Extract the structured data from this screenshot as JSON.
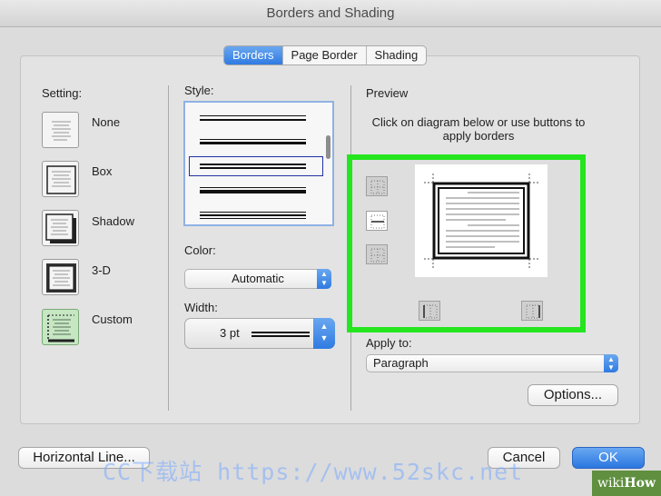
{
  "window": {
    "title": "Borders and Shading"
  },
  "tabs": [
    {
      "label": "Borders",
      "active": true
    },
    {
      "label": "Page Border",
      "active": false
    },
    {
      "label": "Shading",
      "active": false
    }
  ],
  "setting": {
    "heading": "Setting:",
    "options": [
      {
        "label": "None",
        "icon": "border-none-icon"
      },
      {
        "label": "Box",
        "icon": "border-box-icon"
      },
      {
        "label": "Shadow",
        "icon": "border-shadow-icon"
      },
      {
        "label": "3-D",
        "icon": "border-3d-icon"
      },
      {
        "label": "Custom",
        "icon": "border-custom-icon",
        "selected": true
      }
    ]
  },
  "style": {
    "heading": "Style:",
    "selected_index": 2
  },
  "color": {
    "heading": "Color:",
    "value": "Automatic"
  },
  "width": {
    "heading": "Width:",
    "value": "3 pt"
  },
  "preview": {
    "heading": "Preview",
    "instructions": "Click on diagram below or use buttons to apply borders"
  },
  "apply_to": {
    "heading": "Apply to:",
    "value": "Paragraph"
  },
  "buttons": {
    "options": "Options...",
    "horizontal_line": "Horizontal Line...",
    "cancel": "Cancel",
    "ok": "OK"
  },
  "watermark": {
    "text": "CC下载站 https://www.52skc.net"
  },
  "branding": {
    "prefix": "wiki",
    "suffix": "How"
  },
  "colors": {
    "accent": "#2f7be2",
    "highlight": "#25e51f",
    "selected_setting": "#c6e7c2"
  }
}
